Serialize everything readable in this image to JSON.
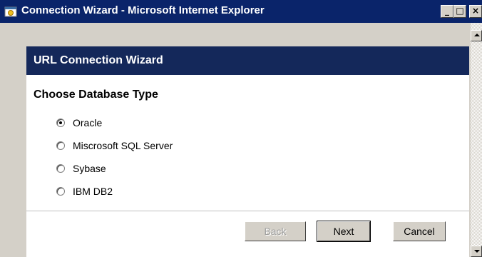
{
  "window": {
    "title": "Connection Wizard - Microsoft Internet Explorer",
    "controls": {
      "minimize": "_",
      "maximize": "□",
      "close": "×"
    }
  },
  "wizard": {
    "header": "URL Connection Wizard",
    "section_title": "Choose Database Type",
    "options": [
      {
        "label": "Oracle",
        "checked": true
      },
      {
        "label": "Miscrosoft SQL Server",
        "checked": false
      },
      {
        "label": "Sybase",
        "checked": false
      },
      {
        "label": "IBM DB2",
        "checked": false
      }
    ],
    "buttons": {
      "back": "Back",
      "next": "Next",
      "cancel": "Cancel"
    }
  },
  "colors": {
    "titlebar": "#0a246a",
    "wizard_header": "#14285a",
    "panel": "#ffffff",
    "chrome": "#d4d0c8"
  }
}
